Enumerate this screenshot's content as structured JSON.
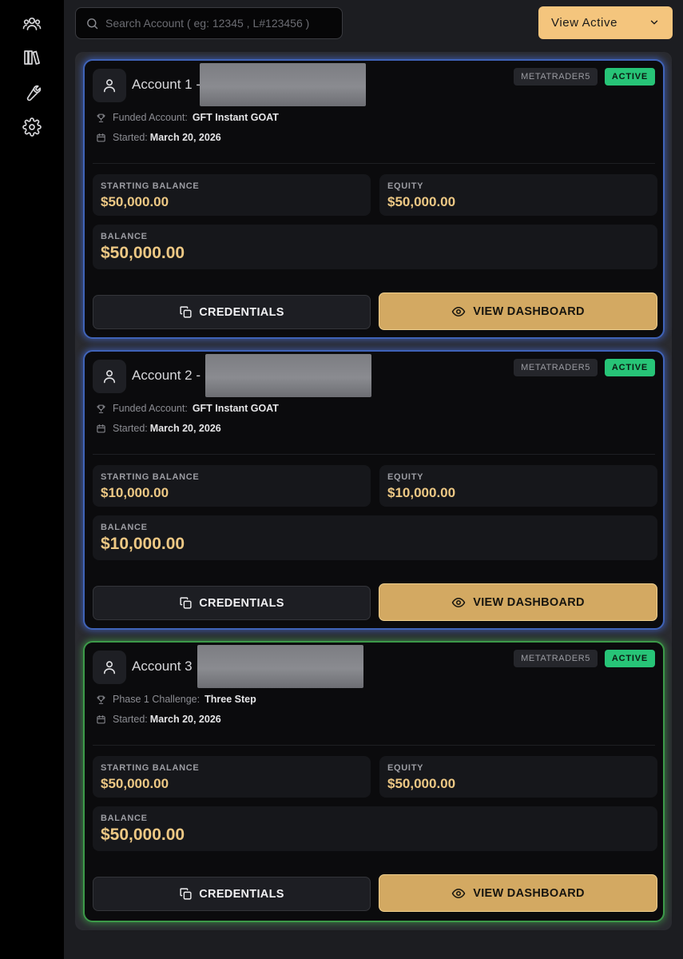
{
  "sidebar": {
    "icons": [
      "users-icon",
      "library-icon",
      "wrench-icon",
      "gear-icon"
    ]
  },
  "search": {
    "placeholder": "Search Account ( eg: 12345 , L#123456 )",
    "value": ""
  },
  "filter": {
    "selected": "View Active"
  },
  "accounts": [
    {
      "name": "Account 1 -",
      "platform": "METATRADER5",
      "status": "ACTIVE",
      "type_label": "Funded Account:",
      "type_value": "GFT Instant GOAT",
      "started_label": "Started:",
      "started_value": "March 20, 2026",
      "starting_balance_label": "STARTING BALANCE",
      "starting_balance": "$50,000.00",
      "equity_label": "EQUITY",
      "equity": "$50,000.00",
      "balance_label": "BALANCE",
      "balance": "$50,000.00",
      "credentials_label": "CREDENTIALS",
      "dashboard_label": "VIEW DASHBOARD",
      "glow": "#3f63b8"
    },
    {
      "name": "Account 2 -",
      "platform": "METATRADER5",
      "status": "ACTIVE",
      "type_label": "Funded Account:",
      "type_value": "GFT Instant GOAT",
      "started_label": "Started:",
      "started_value": "March 20, 2026",
      "starting_balance_label": "STARTING BALANCE",
      "starting_balance": "$10,000.00",
      "equity_label": "EQUITY",
      "equity": "$10,000.00",
      "balance_label": "BALANCE",
      "balance": "$10,000.00",
      "credentials_label": "CREDENTIALS",
      "dashboard_label": "VIEW DASHBOARD",
      "glow": "#3f63b8"
    },
    {
      "name": "Account 3",
      "platform": "METATRADER5",
      "status": "ACTIVE",
      "type_label": "Phase 1 Challenge:",
      "type_value": "Three Step",
      "started_label": "Started:",
      "started_value": "March 20, 2026",
      "starting_balance_label": "STARTING BALANCE",
      "starting_balance": "$50,000.00",
      "equity_label": "EQUITY",
      "equity": "$50,000.00",
      "balance_label": "BALANCE",
      "balance": "$50,000.00",
      "credentials_label": "CREDENTIALS",
      "dashboard_label": "VIEW DASHBOARD",
      "glow": "#3c9a49"
    }
  ],
  "colors": {
    "accent_gold": "#f4c57d",
    "button_gold": "#d3a962",
    "value_gold": "#edc884",
    "active_green": "#27c477"
  }
}
